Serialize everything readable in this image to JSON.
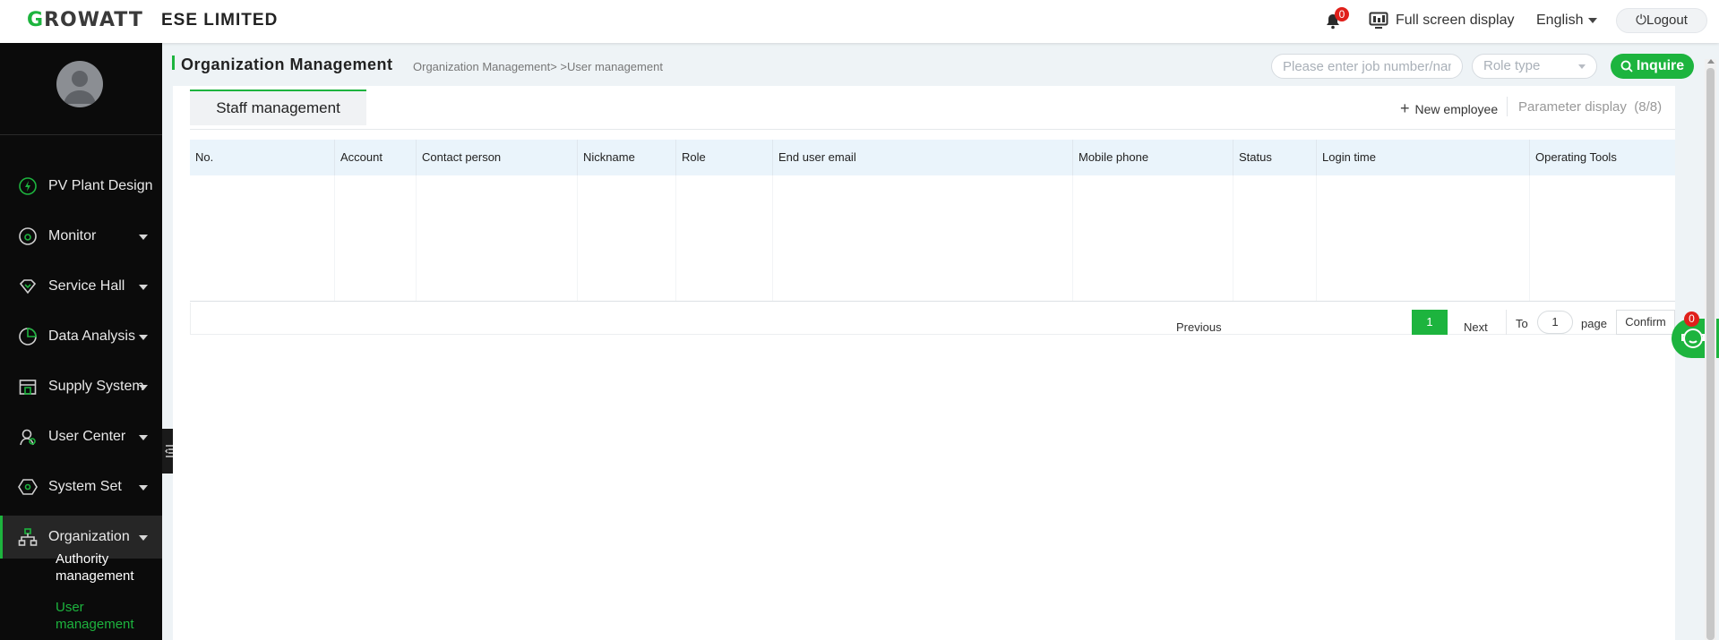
{
  "header": {
    "logo_first": "G",
    "logo_rest": "ROWATT",
    "company": "ESE LIMITED",
    "notification_count": "0",
    "fullscreen_label": "Full screen display",
    "language": "English",
    "logout_label": "Logout"
  },
  "sidebar": {
    "items": [
      {
        "label": "PV Plant Design",
        "icon": "pv-plant-icon"
      },
      {
        "label": "Monitor",
        "icon": "monitor-icon"
      },
      {
        "label": "Service Hall",
        "icon": "diamond-icon"
      },
      {
        "label": "Data Analysis",
        "icon": "pie-chart-icon"
      },
      {
        "label": "Supply System",
        "icon": "store-icon"
      },
      {
        "label": "User Center",
        "icon": "user-icon"
      },
      {
        "label": "System Set",
        "icon": "hexagon-icon"
      },
      {
        "label": "Organization",
        "icon": "org-chart-icon"
      }
    ],
    "sub_items": [
      "Authority management",
      "User management"
    ]
  },
  "main": {
    "title": "Organization Management",
    "breadcrumb": "Organization Management> >User management",
    "search_placeholder": "Please enter job number/name",
    "role_placeholder": "Role type",
    "inquire_label": "Inquire",
    "tab_label": "Staff management",
    "new_employee_label": "New employee",
    "param_display_label": "Parameter display",
    "param_display_count": "(8/8)",
    "columns": [
      "No.",
      "Account",
      "Contact person",
      "Nickname",
      "Role",
      "End user email",
      "Mobile phone",
      "Status",
      "Login time",
      "Operating Tools"
    ]
  },
  "pagination": {
    "previous": "Previous",
    "current": "1",
    "next": "Next",
    "to": "To",
    "page_input": "1",
    "page": "page",
    "confirm": "Confirm"
  },
  "chat": {
    "badge": "0"
  },
  "colors": {
    "accent": "#1db43e",
    "sidebar": "#0b0b0b",
    "badge": "#e0201b",
    "table_header": "#eaf4fb"
  }
}
